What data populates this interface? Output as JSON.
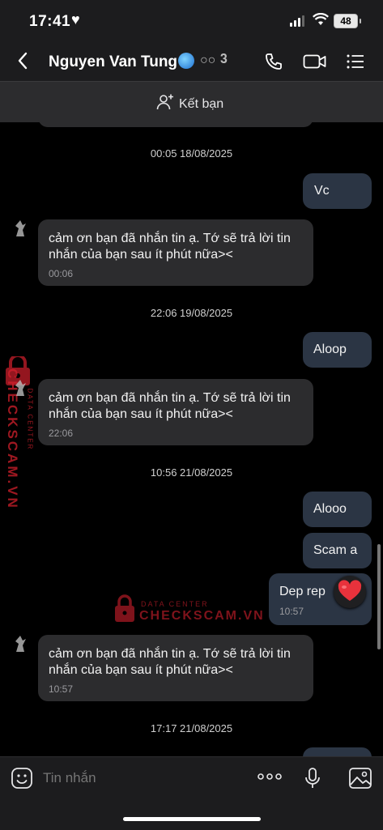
{
  "status_bar": {
    "time": "17:41",
    "battery": "48"
  },
  "header": {
    "contact_name": "Nguyen Van Tung"
  },
  "add_friend": {
    "label": "Kết bạn"
  },
  "messages": [
    {
      "type": "timestamp",
      "text": "00:05 18/08/2025"
    },
    {
      "type": "outgoing",
      "text": "Vc"
    },
    {
      "type": "incoming",
      "text_line1": "cảm ơn bạn đã nhắn tin ạ. Tớ sẽ trả lời tin",
      "text_line2": "nhắn của bạn sau ít phút nữa><",
      "time": "00:06"
    },
    {
      "type": "timestamp",
      "text": "22:06 19/08/2025"
    },
    {
      "type": "outgoing",
      "text": "Aloop"
    },
    {
      "type": "incoming",
      "text_line1": "cảm ơn bạn đã nhắn tin ạ. Tớ sẽ trả lời tin",
      "text_line2": "nhắn của bạn sau ít phút nữa><",
      "time": "22:06"
    },
    {
      "type": "timestamp",
      "text": "10:56 21/08/2025"
    },
    {
      "type": "outgoing",
      "text": "Alooo"
    },
    {
      "type": "outgoing",
      "text": "Scam a"
    },
    {
      "type": "outgoing",
      "text": "Dep rep",
      "time": "10:57",
      "reaction": "heart"
    },
    {
      "type": "incoming",
      "text_line1": "cảm ơn bạn đã nhắn tin ạ. Tớ sẽ trả lời tin",
      "text_line2": "nhắn của bạn sau ít phút nữa><",
      "time": "10:57"
    },
    {
      "type": "timestamp",
      "text": "17:17 21/08/2025"
    }
  ],
  "watermark": {
    "brand": "CHECKSCAM.VN",
    "sub": "DATA CENTER"
  },
  "input": {
    "placeholder": "Tin nhắn"
  },
  "colors": {
    "incoming_bubble": "#2c2c2e",
    "outgoing_bubble": "#2b3544",
    "reaction": "#e8323c",
    "watermark": "#d3202d"
  }
}
